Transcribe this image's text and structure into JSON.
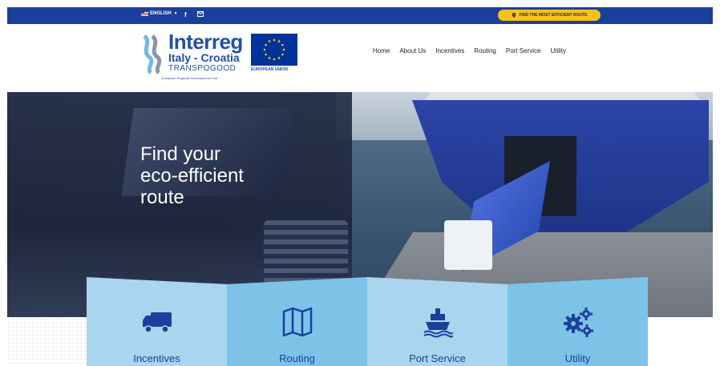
{
  "topbar": {
    "language": "ENGLISH",
    "social_icons": [
      "facebook-icon",
      "mail-icon"
    ],
    "cta_label": "FIND THE MOST EFFICIENT ROUTE",
    "background": "#1b3f9c",
    "cta_color": "#f7c21a"
  },
  "header": {
    "logo": {
      "brand": "Interreg",
      "program": "Italy - Croatia",
      "project": "TRANSPOGOOD",
      "fund": "European Regional Development Fund",
      "eu_label": "EUROPEAN UNION"
    },
    "nav": [
      "Home",
      "About Us",
      "Incentives",
      "Routing",
      "Port Service",
      "Utility"
    ]
  },
  "hero": {
    "title_lines": [
      "Find your",
      "eco-efficient",
      "route"
    ]
  },
  "features": [
    {
      "label": "Incentives",
      "icon": "truck-icon"
    },
    {
      "label": "Routing",
      "icon": "map-icon"
    },
    {
      "label": "Port Service",
      "icon": "ship-icon"
    },
    {
      "label": "Utility",
      "icon": "gears-icon"
    }
  ],
  "colors": {
    "accent_blue": "#1b3f9c",
    "panel_light": "#a9d6ee",
    "panel_mid": "#7cc3e7"
  }
}
